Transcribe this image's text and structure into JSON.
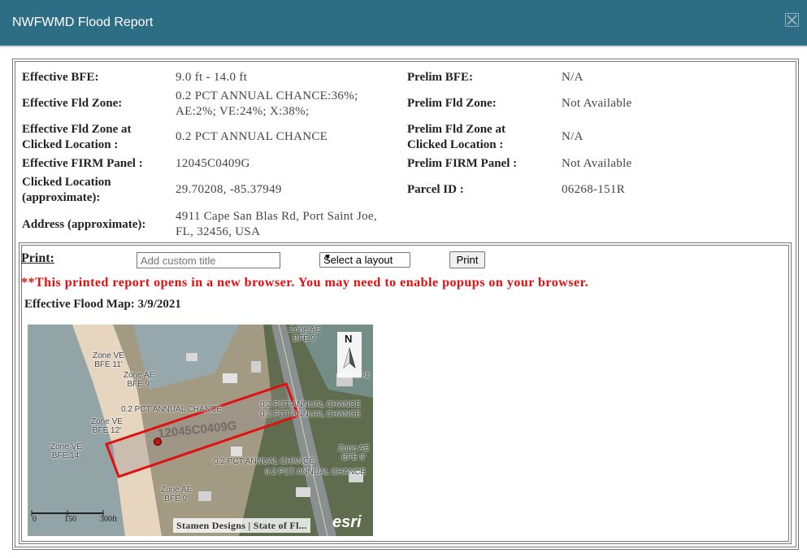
{
  "dialog": {
    "title": "NWFWMD Flood Report"
  },
  "info": {
    "effective_bfe_label": "Effective BFE:",
    "effective_bfe_value": "9.0 ft - 14.0 ft",
    "prelim_bfe_label": "Prelim BFE:",
    "prelim_bfe_value": "N/A",
    "effective_fld_zone_label": "Effective Fld Zone:",
    "effective_fld_zone_value_line1": "0.2 PCT ANNUAL CHANCE:36%;",
    "effective_fld_zone_value_line2": "AE:2%; VE:24%; X:38%;",
    "prelim_fld_zone_label": "Prelim Fld Zone:",
    "prelim_fld_zone_value": "Not Available",
    "effective_zone_clicked_label_line1": "Effective Fld Zone at",
    "effective_zone_clicked_label_line2": "Clicked Location :",
    "effective_zone_clicked_value": "0.2 PCT ANNUAL CHANCE",
    "prelim_zone_clicked_label_line1": "Prelim Fld Zone at",
    "prelim_zone_clicked_label_line2": "Clicked Location :",
    "prelim_zone_clicked_value": "N/A",
    "effective_firm_label": "Effective FIRM Panel :",
    "effective_firm_value": "12045C0409G",
    "prelim_firm_label": "Prelim FIRM Panel :",
    "prelim_firm_value": "Not Available",
    "clicked_location_label_line1": "Clicked Location",
    "clicked_location_label_line2": "(approximate):",
    "clicked_location_value": "29.70208, -85.37949",
    "parcel_id_label": "Parcel ID :",
    "parcel_id_value": "06268-151R",
    "address_label": "Address (approximate):",
    "address_value_line1": "4911 Cape San Blas Rd, Port Saint Joe,",
    "address_value_line2": "FL, 32456, USA"
  },
  "print": {
    "label": "Print:",
    "title_placeholder": "Add custom title",
    "layout_selected": "Select a layout",
    "print_button": "Print",
    "warning": "**This printed report opens in a new browser. You may need to enable popups on your browser.",
    "map_title": "Effective Flood Map: 3/9/2021"
  },
  "map": {
    "panel_label": "12045C0409G",
    "zones": {
      "z1a": "Zone AE",
      "z1b": "BFE 9'",
      "z2a": "Zone VE",
      "z2b": "BFE 11'",
      "z3a": "Zone AE",
      "z3b": "BFE 9'",
      "z4": "0.2 PCT ANNUAL CHANCE",
      "z5": "0.2 PCT ANNUAL CHANCE",
      "z6": "0.2 PCT ANNUAL CHANCE",
      "z7a": "Zone VE",
      "z7b": "BFE 12'",
      "z8a": "Zone VE",
      "z8b": "BFE 14'",
      "z9": "0.2 PCT ANNUAL CHANCE",
      "z10": "0.2 PCT ANNUAL CHANCE",
      "z11a": "Zone AE",
      "z11b": "BFE 9'",
      "z12a": "Zone AE",
      "z12b": "BFE 9'",
      "z13": "ZONE AE"
    },
    "north_label": "N",
    "scale_0": "0",
    "scale_150": "150",
    "scale_300": "300ft",
    "attribution": "Stamen Designs | State of Fl...",
    "esri": "esri"
  }
}
